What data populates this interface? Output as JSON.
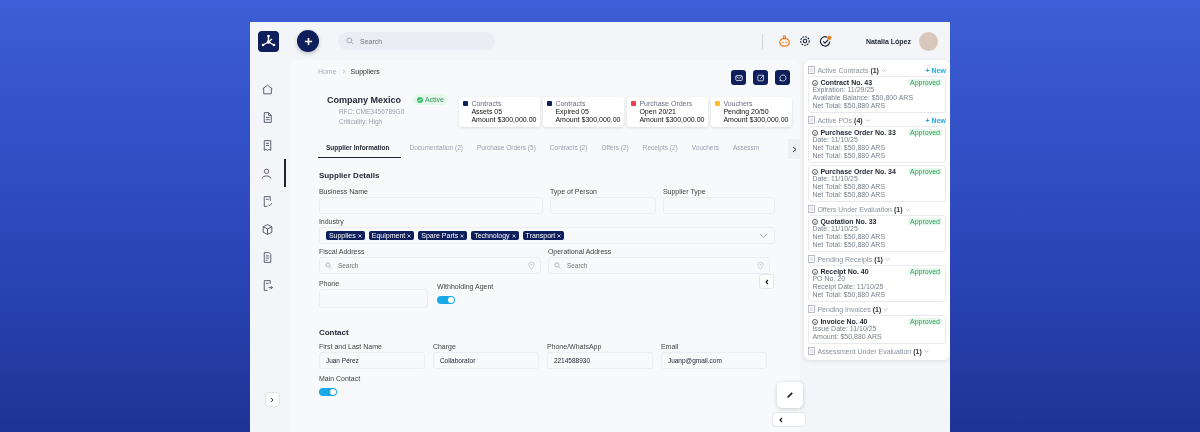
{
  "topbar": {
    "search": {
      "placeholder": "Search"
    },
    "user_name": "Natalia López"
  },
  "sidebar": {
    "items": [
      {
        "kind": "home",
        "selected": false
      },
      {
        "kind": "document",
        "selected": false
      },
      {
        "kind": "receipt",
        "selected": false
      },
      {
        "kind": "user",
        "selected": true
      },
      {
        "kind": "document-check",
        "selected": false
      },
      {
        "kind": "box",
        "selected": false
      },
      {
        "kind": "document-list",
        "selected": false
      },
      {
        "kind": "document-export",
        "selected": false
      }
    ]
  },
  "breadcrumb": [
    "Home",
    "Suppliers"
  ],
  "company": {
    "name": "Company Mexico",
    "status": "Active",
    "rfc": "RFC: CME3456789G0",
    "criticality": "Criticality: High"
  },
  "stats": [
    {
      "color": "#0e1f5b",
      "title": "Contracts",
      "line1": "Assets 05",
      "line2": "Amount $300,000.00"
    },
    {
      "color": "#0e1f5b",
      "title": "Contracts",
      "line1": "Expired 05",
      "line2": "Amount $300,000.00"
    },
    {
      "color": "#f23c52",
      "title": "Purchase Orders",
      "line1": "Open 20/21",
      "line2": "Amount $300,000.00"
    },
    {
      "color": "#fbbd2a",
      "title": "Vouchers",
      "line1": "Pending 20/50",
      "line2": "Amount $300,000.00"
    }
  ],
  "tabs": [
    {
      "label": "Supplier Information",
      "selected": true
    },
    {
      "label": "Documentation (2)",
      "selected": false
    },
    {
      "label": "Purchase Orders (5)",
      "selected": false
    },
    {
      "label": "Contracts (2)",
      "selected": false
    },
    {
      "label": "Offers (2)",
      "selected": false
    },
    {
      "label": "Receipts (2)",
      "selected": false
    },
    {
      "label": "Vouchers",
      "selected": false
    },
    {
      "label": "Assessm",
      "selected": false
    }
  ],
  "supplier_details": {
    "title": "Supplier Details",
    "business_name": {
      "label": "Business Name"
    },
    "type_of_person": {
      "label": "Type of Person"
    },
    "supplier_type": {
      "label": "Supplier Type"
    },
    "industry": {
      "label": "Industry",
      "tags": [
        "Supplies",
        "Equipment",
        "Spare Parts",
        "Technology",
        "Transport"
      ]
    },
    "fiscal_address": {
      "label": "Fiscal Address",
      "placeholder": "Search"
    },
    "operational_address": {
      "label": "Operational Address",
      "placeholder": "Search"
    },
    "phone": {
      "label": "Phone"
    },
    "withholding_agent": {
      "label": "Withholding Agent",
      "on": true
    }
  },
  "contact": {
    "title": "Contact",
    "fields": [
      {
        "label": "First and Last Name",
        "value": "Juan Pérez"
      },
      {
        "label": "Charge",
        "value": "Collaborator"
      },
      {
        "label": "Phone/WhatsApp",
        "value": "2214588930"
      },
      {
        "label": "Email",
        "value": "Juanp@gmail.com"
      }
    ],
    "main_contact": {
      "label": "Main Contact",
      "on": true
    }
  },
  "right_panel": {
    "sections": [
      {
        "title": "Active Contracts",
        "count": "(1)",
        "new_label": "+ New",
        "cards": [
          {
            "title": "Contract No. 43",
            "status": "Approved",
            "lines": [
              "Expiration: 11/29/25",
              "Available Balance: $50,800 ARS",
              "Net Total: $50,880 ARS"
            ]
          }
        ]
      },
      {
        "title": "Active POs",
        "count": "(4)",
        "new_label": "+ New",
        "cards": [
          {
            "title": "Purchase Order No. 33",
            "status": "Approved",
            "lines": [
              "Date: 11/10/25",
              "Net Total: $50,880 ARS",
              "Net Total: $50,880 ARS"
            ]
          },
          {
            "title": "Purchase Order No. 34",
            "status": "Approved",
            "lines": [
              "Date: 11/10/25",
              "Net Total: $50,880 ARS",
              "Net Total: $50,880 ARS"
            ]
          }
        ]
      },
      {
        "title": "Offers Under Evaluation",
        "count": "(1)",
        "cards": [
          {
            "title": "Quotation No. 33",
            "status": "Approved",
            "lines": [
              "Date: 11/10/25",
              "Net Total: $50,880 ARS",
              "Net Total: $50,880 ARS"
            ]
          }
        ]
      },
      {
        "title": "Pending Receipts",
        "count": "(1)",
        "cards": [
          {
            "title": "Receipt No. 40",
            "status": "Approved",
            "lines": [
              "PO No. 20",
              "Receipt Date: 11/10/25",
              "Net Total: $50,880 ARS"
            ]
          }
        ]
      },
      {
        "title": "Pending Invoices",
        "count": "(1)",
        "cards": [
          {
            "title": "Invoice No. 40",
            "status": "Approved",
            "lines": [
              "Issue Date: 11/10/25",
              "Amount: $50,880 ARS"
            ]
          }
        ]
      },
      {
        "title": "Assessment Under Evaluation",
        "count": "(1)"
      }
    ]
  }
}
